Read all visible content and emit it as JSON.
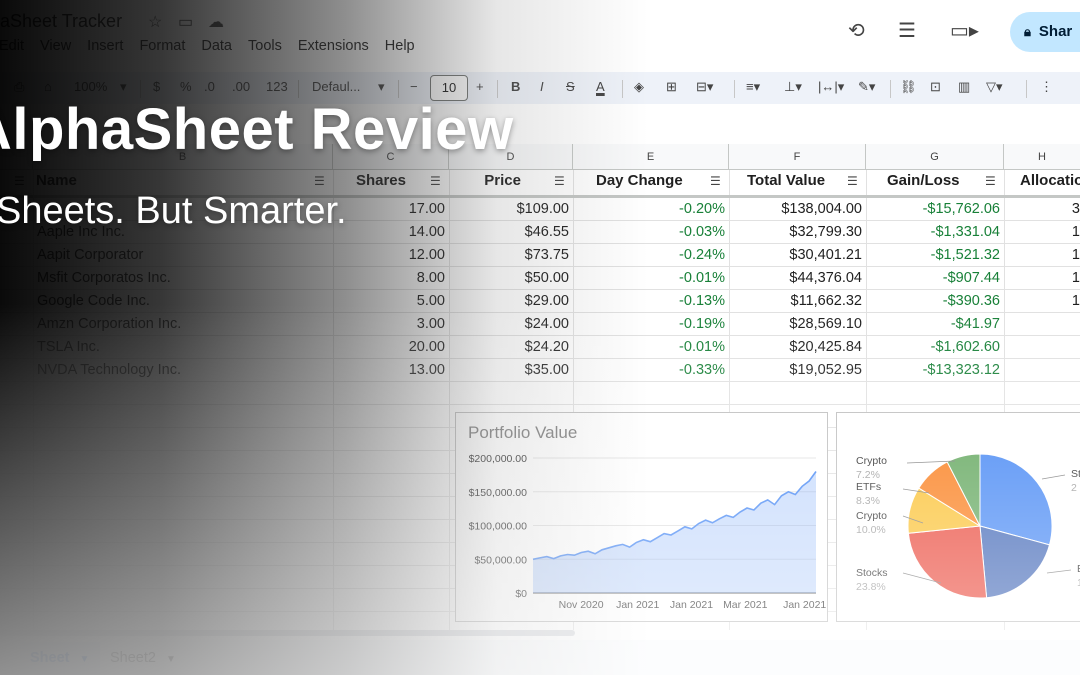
{
  "app": {
    "doc_title": "aSheet Tracker",
    "menu": [
      "Edit",
      "View",
      "Insert",
      "Format",
      "Data",
      "Tools",
      "Extensions",
      "Help"
    ],
    "share_label": "Shar"
  },
  "toolbar": {
    "zoom": "100%",
    "currency": "$",
    "percent": "%",
    "number_format": "123",
    "font": "Defaul...",
    "font_size": "10",
    "bold": "B",
    "italic": "I",
    "text_color_letter": "A"
  },
  "grid": {
    "column_letters": [
      "B",
      "C",
      "D",
      "E",
      "F",
      "G",
      "H"
    ],
    "headers": [
      "Name",
      "Shares",
      "Price",
      "Day Change",
      "Total Value",
      "Gain/Loss",
      "Allocatio"
    ],
    "rows": [
      [
        "",
        "17.00",
        "$109.00",
        "-0.20%",
        "$138,004.00",
        "-$15,762.06",
        "3"
      ],
      [
        "Aaple Inc Inc.",
        "14.00",
        "$46.55",
        "-0.03%",
        "$32,799.30",
        "-$1,331.04",
        "1"
      ],
      [
        "Aapit Corporator",
        "12.00",
        "$73.75",
        "-0.24%",
        "$30,401.21",
        "-$1,521.32",
        "1"
      ],
      [
        "Msfit Corporatos Inc.",
        "8.00",
        "$50.00",
        "-0.01%",
        "$44,376.04",
        "-$907.44",
        "1"
      ],
      [
        "Google Code Inc.",
        "5.00",
        "$29.00",
        "-0.13%",
        "$11,662.32",
        "-$390.36",
        "1"
      ],
      [
        "Amzn Corporation Inc.",
        "3.00",
        "$24.00",
        "-0.19%",
        "$28,569.10",
        "-$41.97",
        ""
      ],
      [
        "TSLA Inc.",
        "20.00",
        "$24.20",
        "-0.01%",
        "$20,425.84",
        "-$1,602.60",
        ""
      ],
      [
        "NVDA Technology Inc.",
        "13.00",
        "$35.00",
        "-0.33%",
        "$19,052.95",
        "-$13,323.12",
        ""
      ]
    ]
  },
  "chart_data": [
    {
      "type": "area",
      "title": "Portfolio Value",
      "xlabel": "",
      "ylabel": "",
      "ylim": [
        0,
        200000
      ],
      "y_ticks": [
        "$200,000.00",
        "$150,000.00",
        "$100,000.00",
        "$50,000.00",
        "$0"
      ],
      "x_ticks": [
        "Nov 2020",
        "Jan 2021",
        "Jan 2021",
        "Mar 2021",
        "Jan 2021"
      ],
      "values": [
        50000,
        52000,
        54000,
        51000,
        55000,
        57000,
        56000,
        60000,
        62000,
        58000,
        64000,
        67000,
        70000,
        72000,
        68000,
        75000,
        79000,
        76000,
        82000,
        88000,
        86000,
        92000,
        98000,
        95000,
        103000,
        108000,
        104000,
        110000,
        115000,
        112000,
        120000,
        126000,
        123000,
        133000,
        138000,
        131000,
        144000,
        150000,
        146000,
        158000,
        166000,
        180000
      ],
      "color": "#4285f4",
      "grid": true
    },
    {
      "type": "pie",
      "slices": [
        {
          "label": "St",
          "pct_text": "2",
          "value": 28.0,
          "color": "#4285f4"
        },
        {
          "label": "B",
          "pct_text": "1",
          "value": 18.5,
          "color": "#3c63b5"
        },
        {
          "label": "Stocks",
          "pct_text": "23.8%",
          "value": 23.8,
          "color": "#ea4335"
        },
        {
          "label": "Crypto",
          "pct_text": "10.0%",
          "value": 10.0,
          "color": "#fbc02d"
        },
        {
          "label": "ETFs",
          "pct_text": "8.3%",
          "value": 8.3,
          "color": "#fa7b17"
        },
        {
          "label": "Crypto",
          "pct_text": "7.2%",
          "value": 7.2,
          "color": "#5fa55a"
        }
      ]
    }
  ],
  "sheets": {
    "tabs": [
      "Sheet",
      "Sheet2"
    ],
    "active": "Sheet"
  },
  "overlay": {
    "title": "AlphaSheet Review",
    "subtitle": "Sheets. But Smarter."
  }
}
